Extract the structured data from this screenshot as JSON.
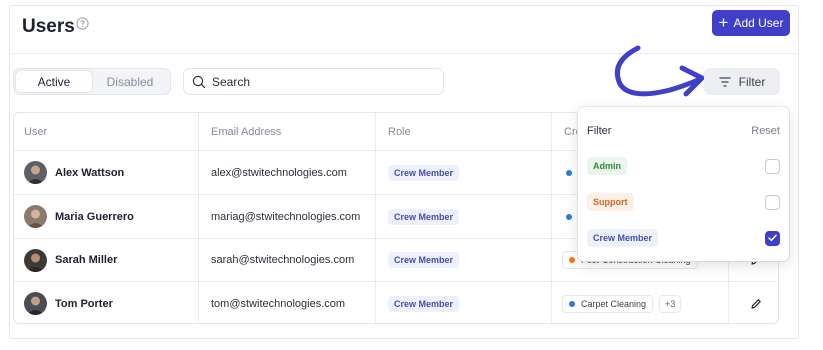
{
  "header": {
    "title": "Users",
    "add_button_label": "Add User"
  },
  "colors": {
    "accent": "#3f3fc9",
    "arrow": "#3f3fc9"
  },
  "status_tabs": [
    {
      "label": "Active",
      "selected": true
    },
    {
      "label": "Disabled",
      "selected": false
    }
  ],
  "search": {
    "placeholder": "Search",
    "value": ""
  },
  "filter_button_label": "Filter",
  "table": {
    "columns": [
      "User",
      "Email Address",
      "Role",
      "Cre"
    ],
    "rows": [
      {
        "name": "Alex  Wattson",
        "email": "alex@stwitechnologies.com",
        "role": "Crew Member",
        "service": "",
        "service_color": "#2b7ae4",
        "more": ""
      },
      {
        "name": "Maria Guerrero",
        "email": "mariag@stwitechnologies.com",
        "role": "Crew Member",
        "service": "",
        "service_color": "#2b7ae4",
        "more": ""
      },
      {
        "name": "Sarah Miller",
        "email": "sarah@stwitechnologies.com",
        "role": "Crew Member",
        "service": "Post-Construction Cleaning",
        "service_color": "#f07a1e",
        "more": ""
      },
      {
        "name": "Tom Porter",
        "email": "tom@stwitechnologies.com",
        "role": "Crew Member",
        "service": "Carpet Cleaning",
        "service_color": "#2b7ae4",
        "more": "+3"
      }
    ]
  },
  "filter_menu": {
    "title": "Filter",
    "reset_label": "Reset",
    "options": [
      {
        "label": "Admin",
        "checked": false,
        "text_color": "#2f8a3b",
        "bg_color": "#eaf6ec"
      },
      {
        "label": "Support",
        "checked": false,
        "text_color": "#d0652a",
        "bg_color": "#fdf0e7"
      },
      {
        "label": "Crew Member",
        "checked": true,
        "text_color": "#4350a8",
        "bg_color": "#eef1fb"
      }
    ]
  }
}
